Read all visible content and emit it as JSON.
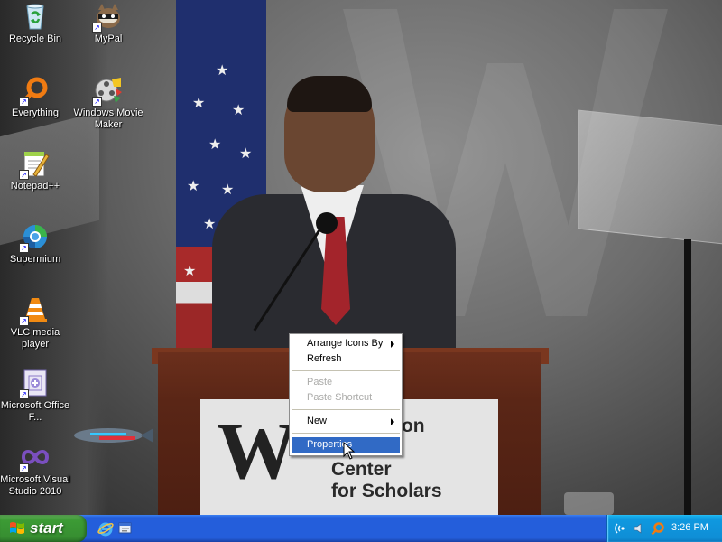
{
  "desktop": {
    "icons": [
      {
        "label": "Recycle Bin",
        "icon": "recycle-bin-icon"
      },
      {
        "label": "MyPal",
        "icon": "mypal-icon"
      },
      {
        "label": "Everything",
        "icon": "everything-search-icon"
      },
      {
        "label": "Windows Movie Maker",
        "icon": "movie-maker-icon"
      },
      {
        "label": "Notepad++",
        "icon": "notepad-plus-plus-icon"
      },
      {
        "label": "Supermium",
        "icon": "supermium-browser-icon"
      },
      {
        "label": "VLC media player",
        "icon": "vlc-cone-icon"
      },
      {
        "label": "Microsoft Office F...",
        "icon": "office-document-icon"
      },
      {
        "label": "Microsoft Visual Studio 2010",
        "icon": "visual-studio-icon"
      }
    ]
  },
  "wallpaper": {
    "sign_text": "ow Wilson\nional\nCenter\nfor Scholars"
  },
  "context_menu": {
    "items": [
      {
        "label": "Arrange Icons By",
        "submenu": true
      },
      {
        "label": "Refresh"
      },
      {
        "label": "Paste",
        "disabled": true
      },
      {
        "label": "Paste Shortcut",
        "disabled": true
      },
      {
        "label": "New",
        "submenu": true
      },
      {
        "label": "Properties",
        "selected": true
      }
    ]
  },
  "taskbar": {
    "start_label": "start",
    "quick_launch": [
      "internet-explorer-icon",
      "show-desktop-icon"
    ],
    "tray_icons": [
      "network-icon",
      "volume-icon",
      "everything-search-icon"
    ],
    "clock": "3:26 PM"
  },
  "colors": {
    "taskbar": "#245edb",
    "start_button": "#3c9b35",
    "tray": "#0f8ed6",
    "menu_highlight": "#316ac5"
  }
}
